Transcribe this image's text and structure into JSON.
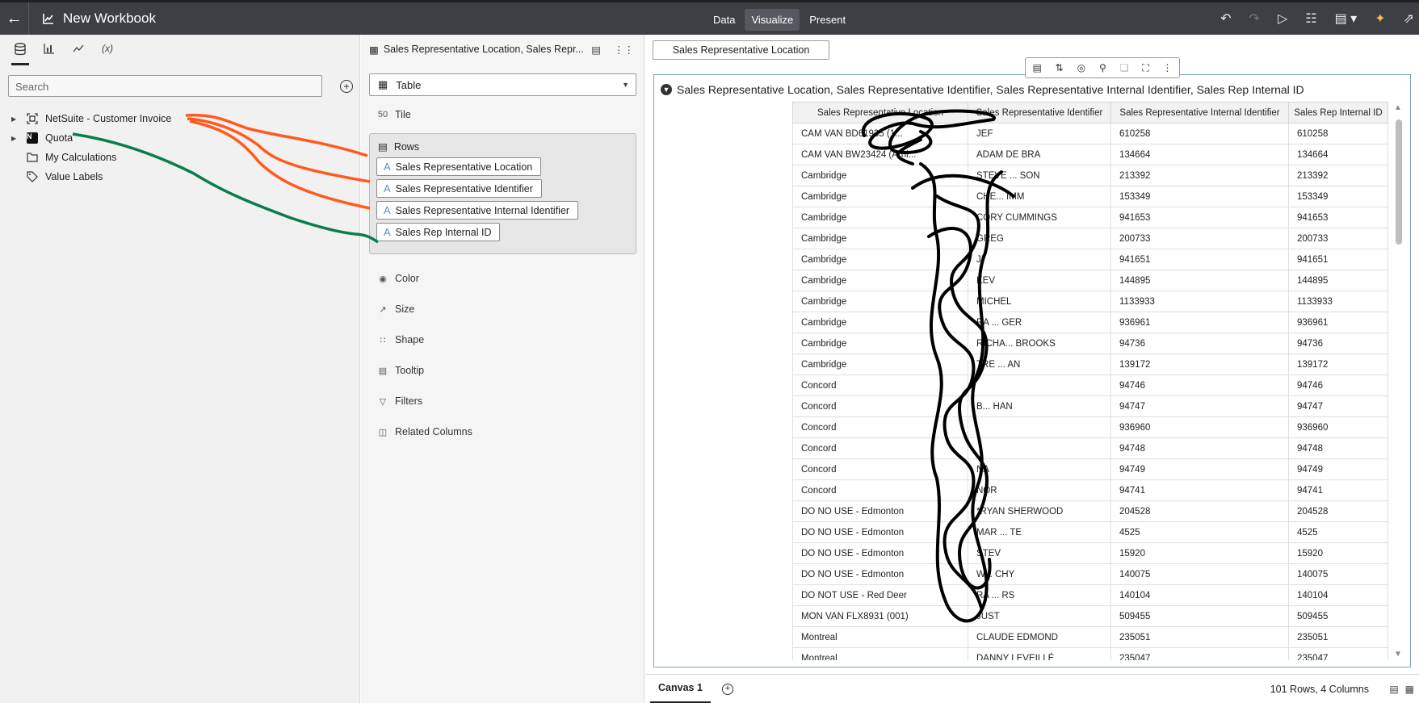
{
  "header": {
    "back_icon": "arrow-left-icon",
    "title": "New Workbook",
    "modes": [
      {
        "label": "Data",
        "active": false
      },
      {
        "label": "Visualize",
        "active": true
      },
      {
        "label": "Present",
        "active": false
      }
    ]
  },
  "data_panel": {
    "search_placeholder": "Search",
    "tree": [
      {
        "label": "NetSuite - Customer Invoice",
        "icon": "dataset-icon",
        "expandable": true
      },
      {
        "label": "Quota",
        "icon": "netsuite-icon",
        "expandable": true
      },
      {
        "label": "My Calculations",
        "icon": "folder-icon",
        "expandable": false
      },
      {
        "label": "Value Labels",
        "icon": "tag-icon",
        "expandable": false
      }
    ]
  },
  "grammar_panel": {
    "header_title": "Sales Representative Location, Sales Repr...",
    "viz_type": "Table",
    "tile_label": "Tile",
    "rows_label": "Rows",
    "row_pills": [
      "Sales Representative Location",
      "Sales Representative Identifier",
      "Sales Representative Internal Identifier",
      "Sales Rep Internal ID"
    ],
    "sections": [
      "Color",
      "Size",
      "Shape",
      "Tooltip",
      "Filters",
      "Related Columns"
    ]
  },
  "canvas": {
    "filter_pill": "Sales Representative Location",
    "viz_title": "Sales Representative Location, Sales Representative Identifier, Sales Representative Internal Identifier, Sales Rep Internal ID",
    "table": {
      "columns": [
        "Sales Representative Location",
        "Sales Representative Identifier",
        "Sales Representative Internal Identifier",
        "Sales Rep Internal ID"
      ],
      "rows": [
        [
          "CAM VAN BD61935 (1... ",
          "JEF",
          "610258",
          "610258"
        ],
        [
          "CAM VAN BW23424 (Arni... ",
          "ADAM DE BRA",
          "134664",
          "134664"
        ],
        [
          "Cambridge",
          "STEVE ... SON",
          "213392",
          "213392"
        ],
        [
          "Cambridge",
          "CHE... IMM",
          "153349",
          "153349"
        ],
        [
          "Cambridge",
          "CORY CUMMINGS",
          "941653",
          "941653"
        ],
        [
          "Cambridge",
          "GREG",
          "200733",
          "200733"
        ],
        [
          "Cambridge",
          "JI",
          "941651",
          "941651"
        ],
        [
          "Cambridge",
          "KEV",
          "144895",
          "144895"
        ],
        [
          "Cambridge",
          "MICHEL",
          "1133933",
          "1133933"
        ],
        [
          "Cambridge",
          "RA ... GER",
          "936961",
          "936961"
        ],
        [
          "Cambridge",
          "RICHA... BROOKS",
          "94736",
          "94736"
        ],
        [
          "Cambridge",
          "TRE ... AN",
          "139172",
          "139172"
        ],
        [
          "Concord",
          "",
          "94746",
          "94746"
        ],
        [
          "Concord",
          "B... HAN",
          "94747",
          "94747"
        ],
        [
          "Concord",
          "",
          "936960",
          "936960"
        ],
        [
          "Concord",
          "",
          "94748",
          "94748"
        ],
        [
          "Concord",
          "NA",
          "94749",
          "94749"
        ],
        [
          "Concord",
          "NOR",
          "94741",
          "94741"
        ],
        [
          "DO NO USE - Edmonton",
          "*RYAN SHERWOOD",
          "204528",
          "204528"
        ],
        [
          "DO NO USE - Edmonton",
          "MAR ... TE",
          "4525",
          "4525"
        ],
        [
          "DO NO USE - Edmonton",
          "STEV",
          "15920",
          "15920"
        ],
        [
          "DO NO USE - Edmonton",
          "W... CHY",
          "140075",
          "140075"
        ],
        [
          "DO NOT USE - Red Deer",
          "RA ... RS",
          "140104",
          "140104"
        ],
        [
          "MON VAN FLX8931 (001)",
          "JUST",
          "509455",
          "509455"
        ],
        [
          "Montreal",
          "CLAUDE EDMOND",
          "235051",
          "235051"
        ],
        [
          "Montreal",
          "DANNY LEVEILLÉ",
          "235047",
          "235047"
        ]
      ]
    },
    "canvas_tab": "Canvas 1",
    "row_count": "101 Rows, 4 Columns"
  }
}
